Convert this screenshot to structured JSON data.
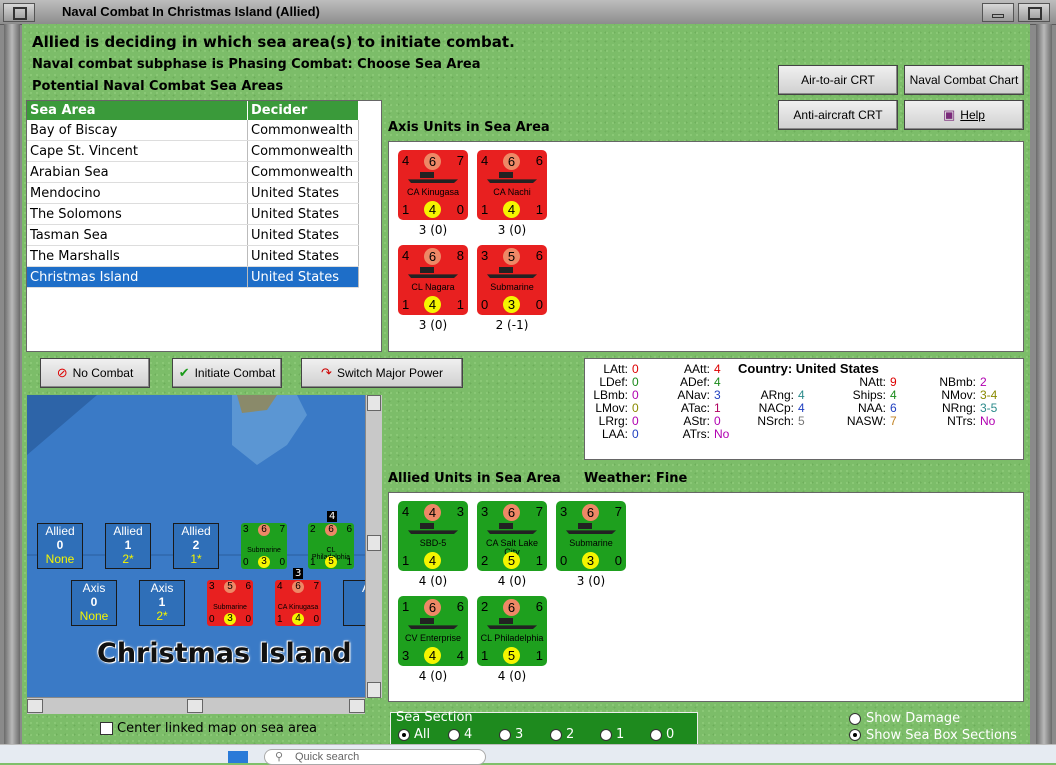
{
  "window": {
    "title": "Naval Combat In Christmas Island (Allied)"
  },
  "header": {
    "line1": "Allied is deciding in which sea area(s) to initiate combat.",
    "line2": "Naval combat subphase is Phasing Combat: Choose Sea Area",
    "line3": "Potential Naval Combat Sea Areas"
  },
  "buttons": {
    "air_to_air": "Air-to-air CRT",
    "naval_chart": "Naval Combat Chart",
    "anti_aircraft": "Anti-aircraft CRT",
    "help": "Help",
    "no_combat": "No Combat",
    "initiate": "Initiate Combat",
    "switch_power": "Switch Major Power"
  },
  "sea_table": {
    "headers": [
      "Sea Area",
      "Decider"
    ],
    "rows": [
      {
        "area": "Bay of Biscay",
        "decider": "Commonwealth"
      },
      {
        "area": "Cape St. Vincent",
        "decider": "Commonwealth"
      },
      {
        "area": "Arabian Sea",
        "decider": "Commonwealth"
      },
      {
        "area": "Mendocino",
        "decider": "United States"
      },
      {
        "area": "The Solomons",
        "decider": "United States"
      },
      {
        "area": "Tasman Sea",
        "decider": "United States"
      },
      {
        "area": "The Marshalls",
        "decider": "United States"
      },
      {
        "area": "Christmas Island",
        "decider": "United States"
      }
    ]
  },
  "axis_units": {
    "label": "Axis Units in Sea Area",
    "units": [
      {
        "tl": "4",
        "tc": "6",
        "tr": "7",
        "name": "CA Kinugasa",
        "bl": "1",
        "bc": "4",
        "br": "0",
        "under": "3 (0)"
      },
      {
        "tl": "4",
        "tc": "6",
        "tr": "6",
        "name": "CA Nachi",
        "bl": "1",
        "bc": "4",
        "br": "1",
        "under": "3 (0)"
      },
      {
        "tl": "4",
        "tc": "6",
        "tr": "8",
        "name": "CL Nagara",
        "bl": "1",
        "bc": "4",
        "br": "1",
        "under": "3 (0)"
      },
      {
        "tl": "3",
        "tc": "5",
        "tr": "6",
        "name": "Submarine",
        "bl": "0",
        "bc": "3",
        "br": "0",
        "under": "2 (-1)"
      }
    ]
  },
  "country_stats": {
    "country_label": "Country: United States",
    "col1": [
      [
        "LAtt:",
        "0"
      ],
      [
        "LDef:",
        "0"
      ],
      [
        "LBmb:",
        "0"
      ],
      [
        "LMov:",
        "0"
      ],
      [
        "LRrg:",
        "0"
      ],
      [
        "LAA:",
        "0"
      ]
    ],
    "col2": [
      [
        "AAtt:",
        "4"
      ],
      [
        "ADef:",
        "4"
      ],
      [
        "ANav:",
        "3"
      ],
      [
        "ATac:",
        "1"
      ],
      [
        "AStr:",
        "0"
      ],
      [
        "ATrs:",
        "No"
      ]
    ],
    "col3": [
      [
        "ARng:",
        "4"
      ],
      [
        "NACp:",
        "4"
      ],
      [
        "NSrch:",
        "5"
      ]
    ],
    "col4": [
      [
        "NAtt:",
        "9"
      ],
      [
        "Ships:",
        "4"
      ],
      [
        "NAA:",
        "6"
      ],
      [
        "NASW:",
        "7"
      ]
    ],
    "col5": [
      [
        "NBmb:",
        "2"
      ],
      [
        "NMov:",
        "3-4"
      ],
      [
        "NRng:",
        "3-5"
      ],
      [
        "NTrs:",
        "No"
      ]
    ]
  },
  "allied_units": {
    "label": "Allied Units in Sea Area",
    "weather": "Weather:  Fine",
    "units": [
      {
        "tl": "4",
        "tc": "4",
        "tr": "3",
        "name": "SBD-5",
        "bl": "1",
        "bc": "4",
        "br": "",
        "under": "4 (0)"
      },
      {
        "tl": "3",
        "tc": "6",
        "tr": "7",
        "name": "CA Salt Lake City",
        "bl": "2",
        "bc": "5",
        "br": "1",
        "under": "4 (0)"
      },
      {
        "tl": "3",
        "tc": "6",
        "tr": "7",
        "name": "Submarine",
        "bl": "0",
        "bc": "3",
        "br": "0",
        "under": "3 (0)"
      },
      {
        "tl": "1",
        "tc": "6",
        "tr": "6",
        "name": "CV Enterprise",
        "bl": "3",
        "bc": "4",
        "br": "4",
        "under": "4 (0)"
      },
      {
        "tl": "2",
        "tc": "6",
        "tr": "6",
        "name": "CL Philadelphia",
        "bl": "1",
        "bc": "5",
        "br": "1",
        "under": "4 (0)"
      }
    ]
  },
  "map": {
    "title": "Christmas Island",
    "allied_boxes": [
      {
        "t": "Allied",
        "n": "0",
        "s": "None"
      },
      {
        "t": "Allied",
        "n": "1",
        "s": "2*"
      },
      {
        "t": "Allied",
        "n": "2",
        "s": "1*"
      }
    ],
    "axis_boxes": [
      {
        "t": "Axis",
        "n": "0",
        "s": "None"
      },
      {
        "t": "Axis",
        "n": "1",
        "s": "2*"
      },
      {
        "t": "A"
      }
    ],
    "stack_allied": "4",
    "stack_axis": "3",
    "mini_allied": [
      {
        "a": "3",
        "b": "6",
        "c": "7",
        "nm": "Submarine",
        "d": "0",
        "e": "3",
        "f": "0"
      },
      {
        "a": "2",
        "b": "6",
        "c": "6",
        "nm": "CL Philadelphia",
        "d": "1",
        "e": "5",
        "f": "1"
      }
    ],
    "mini_axis": [
      {
        "a": "3",
        "b": "5",
        "c": "6",
        "nm": "Submarine",
        "d": "0",
        "e": "3",
        "f": "0"
      },
      {
        "a": "4",
        "b": "6",
        "c": "7",
        "nm": "CA Kinugasa",
        "d": "1",
        "e": "4",
        "f": "0"
      }
    ]
  },
  "center_map": "Center linked map on sea area",
  "sea_section": {
    "label": "Sea Section",
    "options": [
      "All",
      "4",
      "3",
      "2",
      "1",
      "0"
    ]
  },
  "show_damage": "Show Damage",
  "show_sections": "Show Sea Box Sections",
  "taskbar": {
    "search": "Quick search"
  },
  "colors": {
    "red": "#e82020",
    "green": "#1ea01e",
    "select": "#1e6ec8"
  }
}
